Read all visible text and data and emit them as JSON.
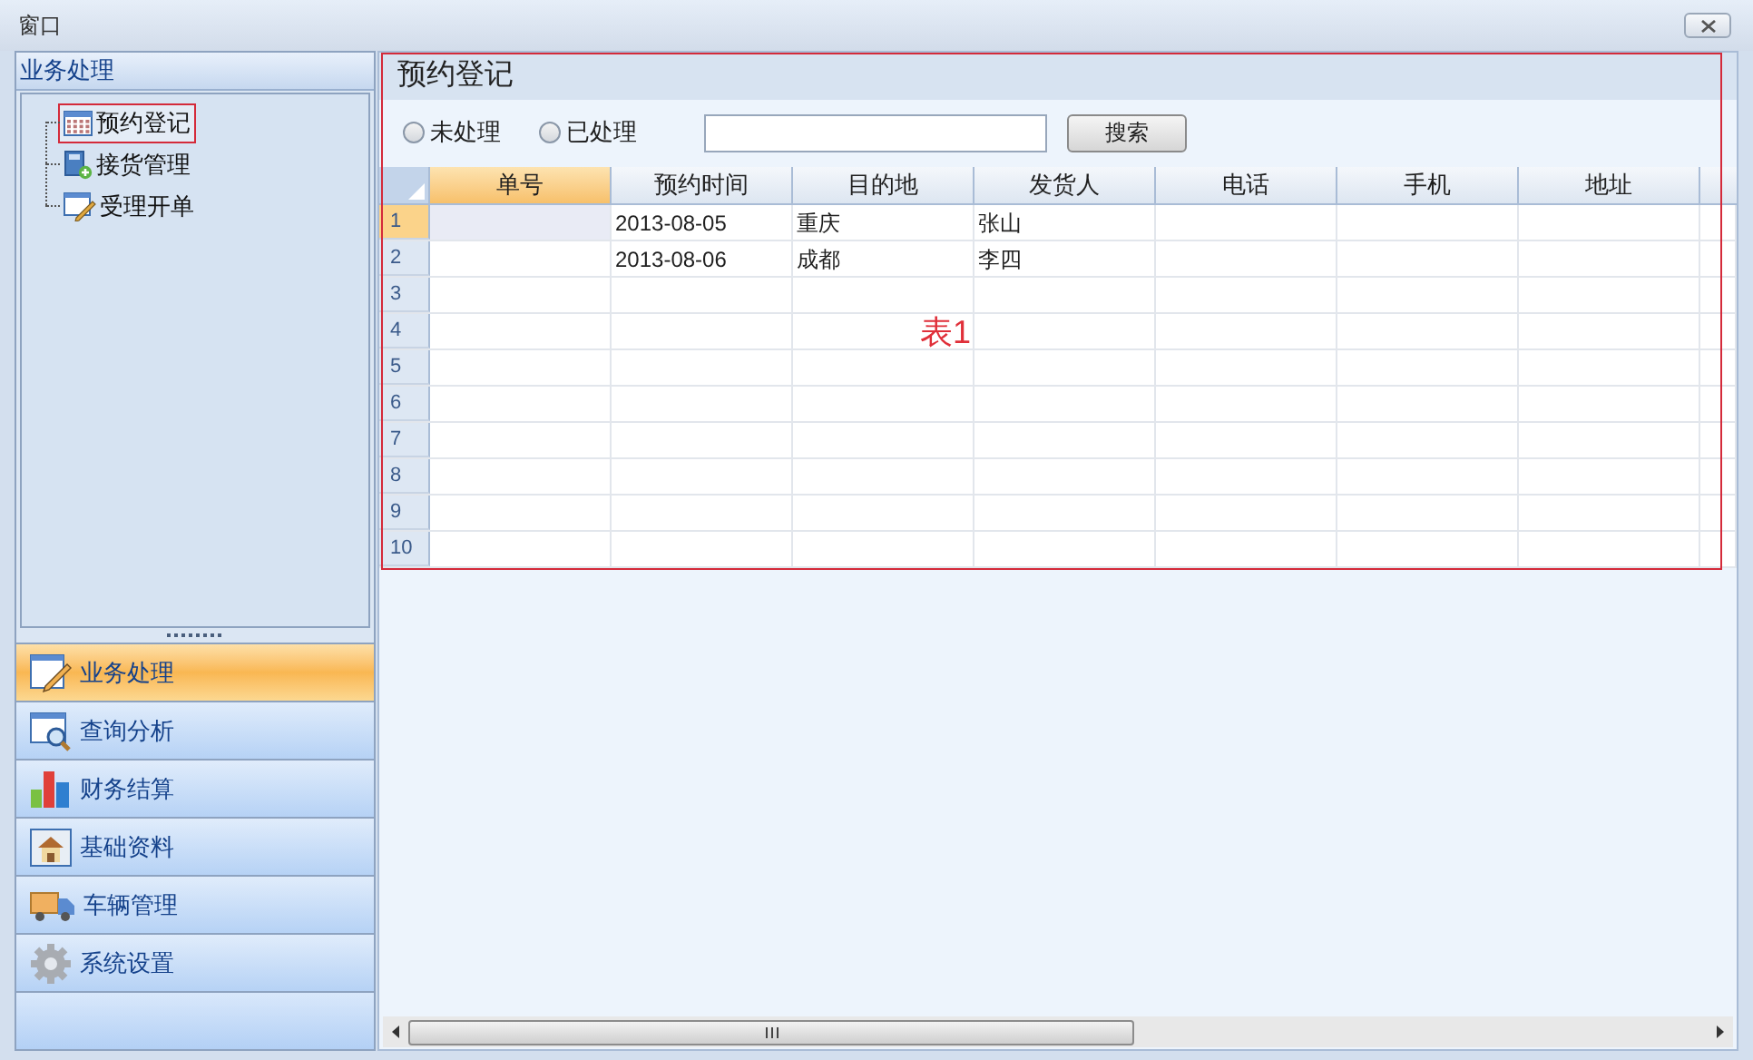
{
  "window": {
    "title": "窗口"
  },
  "sidebar": {
    "header": "业务处理",
    "tree": [
      {
        "label": "预约登记",
        "selected": true
      },
      {
        "label": "接货管理",
        "selected": false
      },
      {
        "label": "受理开单",
        "selected": false
      }
    ],
    "nav": [
      {
        "label": "业务处理",
        "selected": true
      },
      {
        "label": "查询分析",
        "selected": false
      },
      {
        "label": "财务结算",
        "selected": false
      },
      {
        "label": "基础资料",
        "selected": false
      },
      {
        "label": "车辆管理",
        "selected": false
      },
      {
        "label": "系统设置",
        "selected": false
      }
    ]
  },
  "panel": {
    "title": "预约登记",
    "filters": [
      {
        "label": "未处理",
        "checked": false
      },
      {
        "label": "已处理",
        "checked": false
      }
    ],
    "search_button": "搜索",
    "table": {
      "columns": [
        {
          "label": "单号",
          "selected": true
        },
        {
          "label": "预约时间",
          "selected": false
        },
        {
          "label": "目的地",
          "selected": false
        },
        {
          "label": "发货人",
          "selected": false
        },
        {
          "label": "电话",
          "selected": false
        },
        {
          "label": "手机",
          "selected": false
        },
        {
          "label": "地址",
          "selected": false
        }
      ],
      "rows": [
        {
          "number": "1",
          "selected": true,
          "cells": {
            "1": "2013-08-05",
            "2": "重庆",
            "3": "张山"
          }
        },
        {
          "number": "2",
          "selected": false,
          "cells": {
            "1": "2013-08-06",
            "2": "成都",
            "3": "李四"
          }
        },
        {
          "number": "3",
          "selected": false
        },
        {
          "number": "4",
          "selected": false
        },
        {
          "number": "5",
          "selected": false
        },
        {
          "number": "6",
          "selected": false
        },
        {
          "number": "7",
          "selected": false
        },
        {
          "number": "8",
          "selected": false
        },
        {
          "number": "9",
          "selected": false
        },
        {
          "number": "10",
          "selected": false
        }
      ]
    }
  },
  "annotation": {
    "label": "表1"
  }
}
